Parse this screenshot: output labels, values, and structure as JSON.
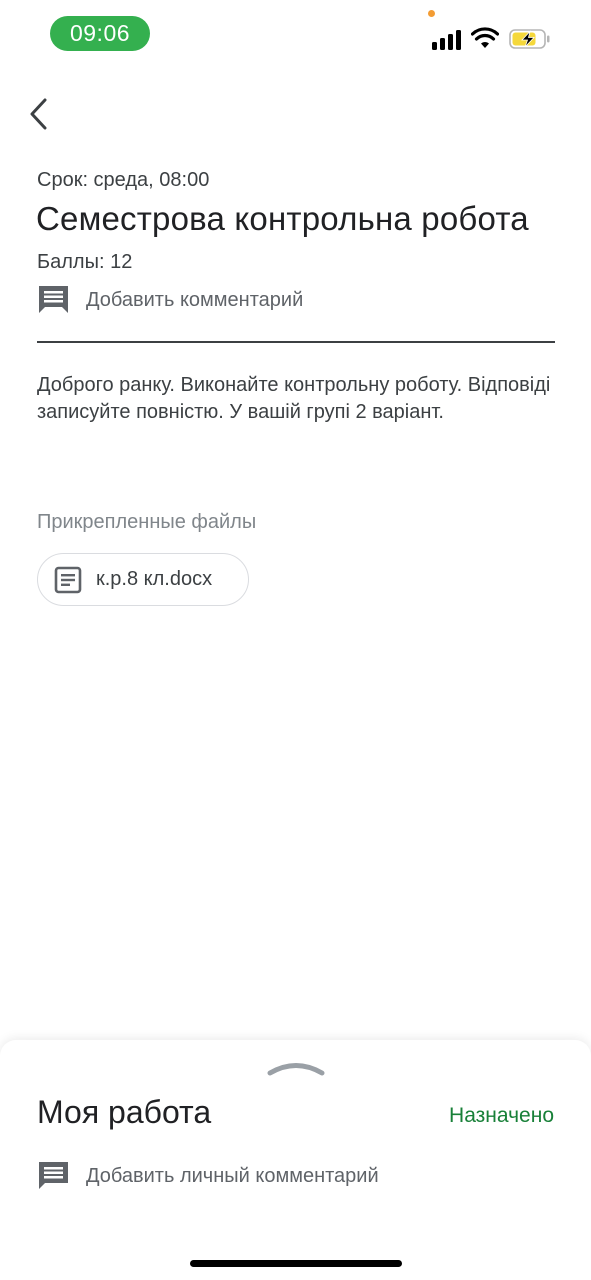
{
  "status_bar": {
    "time": "09:06",
    "icons": [
      "signal-icon",
      "wifi-icon",
      "battery-charging-icon"
    ],
    "time_pill_color": "#34b04f",
    "battery_color": "#f5d83b"
  },
  "nav": {
    "back_icon": "chevron-left-icon"
  },
  "assignment": {
    "due": "Срок: среда, 08:00",
    "title": "Семестрова контрольна робота",
    "points": "Баллы: 12",
    "add_comment_label": "Добавить комментарий",
    "comment_icon": "comment-icon",
    "description": "Доброго ранку.   Виконайте контрольну роботу. Відповіді записуйте повністю. У вашій групі 2 варіант."
  },
  "attachments": {
    "heading": "Прикрепленные файлы",
    "files": [
      {
        "name": "к.р.8 кл.docx",
        "icon": "document-icon"
      }
    ]
  },
  "bottom_sheet": {
    "handle_icon": "chevron-up-icon",
    "title": "Моя работа",
    "status": "Назначено",
    "status_color": "#188038",
    "add_private_comment_label": "Добавить личный комментарий"
  }
}
